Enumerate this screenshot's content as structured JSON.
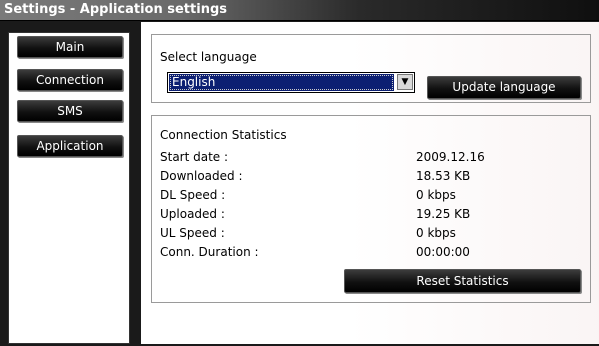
{
  "window": {
    "title": "Settings - Application settings"
  },
  "sidebar": {
    "items": [
      {
        "label": "Main"
      },
      {
        "label": "Connection"
      },
      {
        "label": "SMS"
      },
      {
        "label": "Application"
      }
    ]
  },
  "language": {
    "label": "Select language",
    "selected": "English",
    "update_button": "Update language"
  },
  "stats": {
    "title": "Connection Statistics",
    "rows": [
      {
        "label": "Start date :",
        "value": "2009.12.16"
      },
      {
        "label": "Downloaded :",
        "value": "18.53 KB"
      },
      {
        "label": "DL Speed :",
        "value": "0 kbps"
      },
      {
        "label": "Uploaded :",
        "value": "19.25 KB"
      },
      {
        "label": "UL Speed :",
        "value": "0 kbps"
      },
      {
        "label": "Conn. Duration :",
        "value": "00:00:00"
      }
    ],
    "reset_button": "Reset Statistics"
  },
  "colors": {
    "selection": "#0c1f72",
    "titlebar_start": "#7a7a7a",
    "titlebar_end": "#0f0f0f"
  },
  "icons": {
    "dropdown": "chevron-down-icon"
  }
}
